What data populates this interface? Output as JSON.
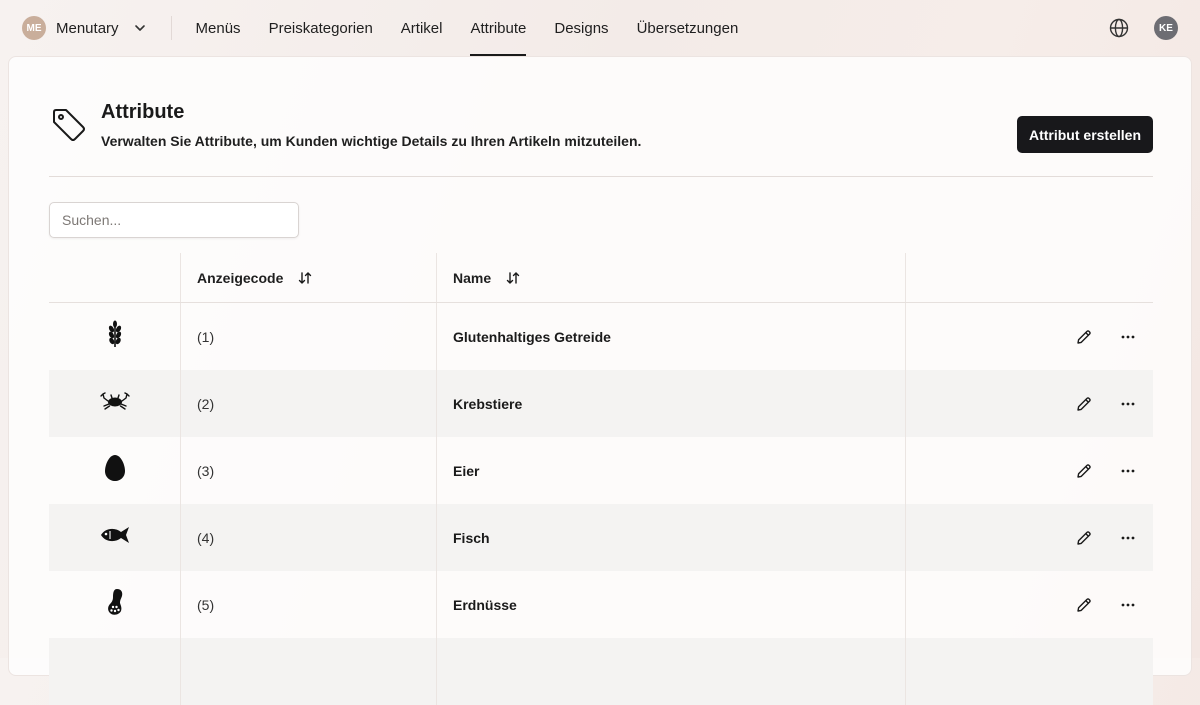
{
  "topbar": {
    "workspace_initials": "ME",
    "workspace_name": "Menutary",
    "nav": [
      {
        "label": "Menüs",
        "active": false
      },
      {
        "label": "Preiskategorien",
        "active": false
      },
      {
        "label": "Artikel",
        "active": false
      },
      {
        "label": "Attribute",
        "active": true
      },
      {
        "label": "Designs",
        "active": false
      },
      {
        "label": "Übersetzungen",
        "active": false
      }
    ],
    "user_initials": "KE"
  },
  "page": {
    "title": "Attribute",
    "subtitle": "Verwalten Sie Attribute, um Kunden wichtige Details zu Ihren Artikeln mitzuteilen.",
    "create_button": "Attribut erstellen"
  },
  "search": {
    "placeholder": "Suchen..."
  },
  "table": {
    "headers": {
      "code": "Anzeigecode",
      "name": "Name"
    },
    "rows": [
      {
        "icon": "wheat-icon",
        "code": "(1)",
        "name": "Glutenhaltiges Getreide"
      },
      {
        "icon": "crab-icon",
        "code": "(2)",
        "name": "Krebstiere"
      },
      {
        "icon": "egg-icon",
        "code": "(3)",
        "name": "Eier"
      },
      {
        "icon": "fish-icon",
        "code": "(4)",
        "name": "Fisch"
      },
      {
        "icon": "peanut-icon",
        "code": "(5)",
        "name": "Erdnüsse"
      },
      {
        "icon": "",
        "code": "",
        "name": ""
      }
    ]
  },
  "colors": {
    "accent": "#18181b",
    "row_alt": "#f4f3f2",
    "avatar_me": "#c9ae9b",
    "avatar_ke": "#6d6d73"
  }
}
